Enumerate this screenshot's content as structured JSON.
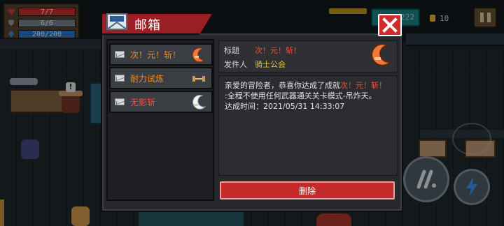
{
  "hud": {
    "hp": "7/7",
    "armor": "6/6",
    "energy": "200/200",
    "hp_ratio": 1,
    "armor_ratio": 1,
    "energy_ratio": 1,
    "gems": "222",
    "coins": "10"
  },
  "mailbox": {
    "title": "邮箱",
    "close_label": "✕",
    "items": [
      {
        "label": "次！元！斩！",
        "icon": "crescent-blade-icon",
        "color": "#f28a22"
      },
      {
        "label": "耐力试炼",
        "icon": "barbell-icon",
        "color": "#f28a22"
      },
      {
        "label": "无影斩",
        "icon": "moon-blade-icon",
        "color": "#ff4a3a"
      }
    ],
    "detail": {
      "subject_label": "标题",
      "subject_value": "次！元！斩！",
      "sender_label": "发件人",
      "sender_value": "骑士公会",
      "body_prefix": "亲爱的冒险者，恭喜你达成了成就",
      "body_highlight": "次！元！斩！",
      "body_line2": ":全程不使用任何武器通关关卡模式-吊炸天。",
      "body_line3": "达成时间：2021/05/31 14:33:07"
    },
    "delete_label": "删除"
  },
  "colors": {
    "accent_red": "#c52a2a",
    "header_red": "#9a1f24",
    "highlight_red": "#ff4a3a",
    "item_orange": "#f28a22",
    "sender_yellow": "#f0c040"
  }
}
